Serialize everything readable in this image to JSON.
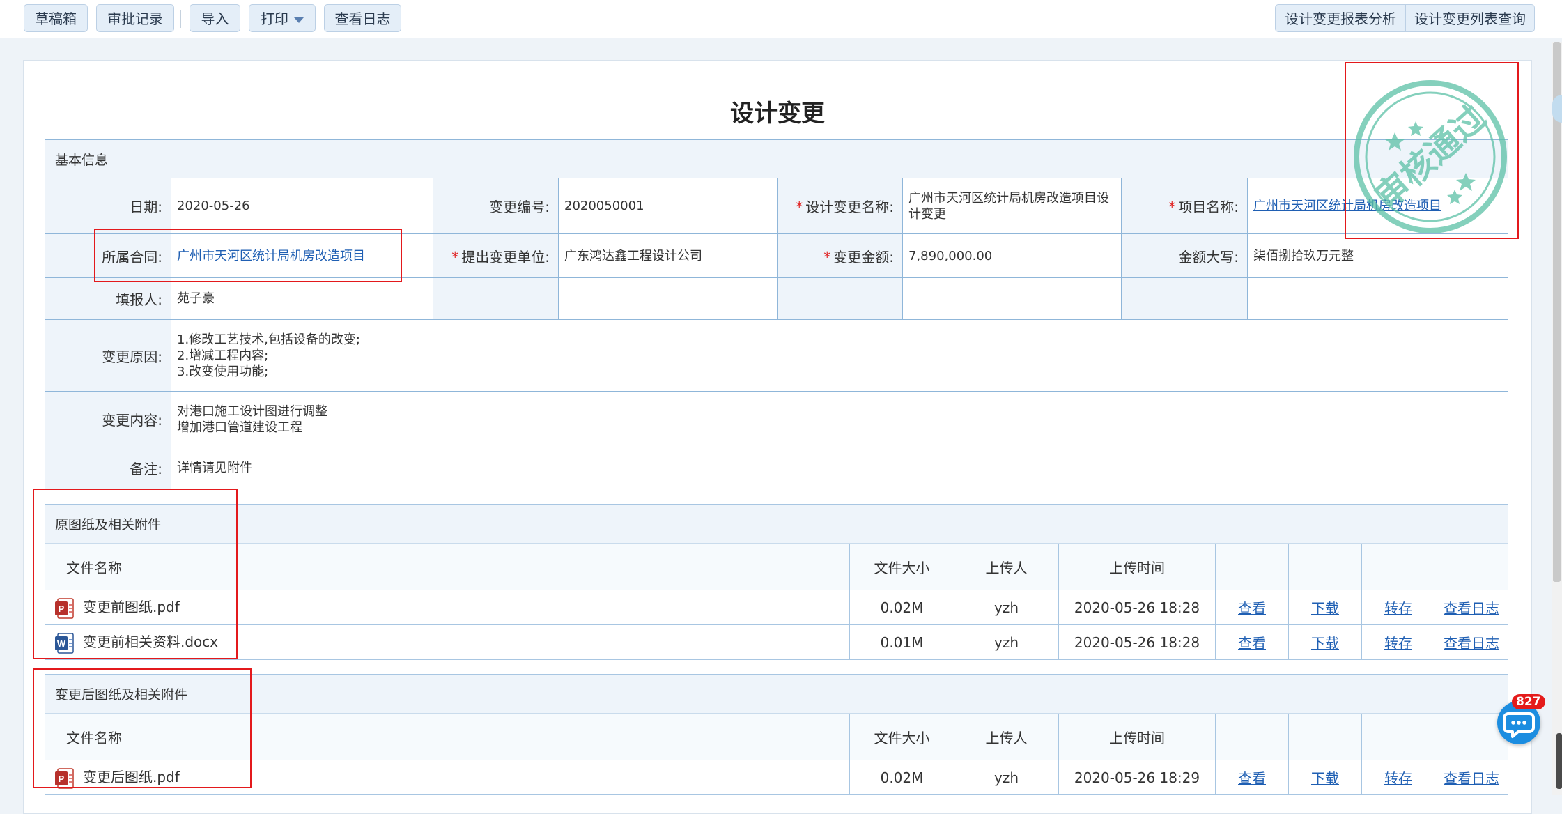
{
  "toolbar": {
    "drafts": "草稿箱",
    "approval_records": "审批记录",
    "import": "导入",
    "print": "打印",
    "view_log": "查看日志",
    "report_analysis": "设计变更报表分析",
    "list_query": "设计变更列表查询"
  },
  "document": {
    "title": "设计变更"
  },
  "basic_info": {
    "section_title": "基本信息",
    "date_label": "日期:",
    "date": "2020-05-26",
    "change_no_label": "变更编号:",
    "change_no": "2020050001",
    "change_name_label": "设计变更名称:",
    "change_name": "广州市天河区统计局机房改造项目设计变更",
    "project_label": "项目名称:",
    "project": "广州市天河区统计局机房改造项目",
    "contract_label": "所属合同:",
    "contract": "广州市天河区统计局机房改造项目",
    "unit_label": "提出变更单位:",
    "unit": "广东鸿达鑫工程设计公司",
    "amount_label": "变更金额:",
    "amount": "7,890,000.00",
    "amount_words_label": "金额大写:",
    "amount_words": "柒佰捌拾玖万元整",
    "filler_label": "填报人:",
    "filler": "苑子豪",
    "reason_label": "变更原因:",
    "reason": "1.修改工艺技术,包括设备的改变;\n2.增减工程内容;\n3.改变使用功能;",
    "content_label": "变更内容:",
    "content": "对港口施工设计图进行调整\n增加港口管道建设工程",
    "remark_label": "备注:",
    "remark": "详情请见附件"
  },
  "attachments_before": {
    "section_title": "原图纸及相关附件",
    "headers": {
      "name": "文件名称",
      "size": "文件大小",
      "uploader": "上传人",
      "time": "上传时间"
    },
    "files": [
      {
        "name": "变更前图纸.pdf",
        "type": "pdf",
        "size": "0.02M",
        "uploader": "yzh",
        "time": "2020-05-26 18:28"
      },
      {
        "name": "变更前相关资料.docx",
        "type": "word",
        "size": "0.01M",
        "uploader": "yzh",
        "time": "2020-05-26 18:28"
      }
    ]
  },
  "attachments_after": {
    "section_title": "变更后图纸及相关附件",
    "headers": {
      "name": "文件名称",
      "size": "文件大小",
      "uploader": "上传人",
      "time": "上传时间"
    },
    "files": [
      {
        "name": "变更后图纸.pdf",
        "type": "pdf",
        "size": "0.02M",
        "uploader": "yzh",
        "time": "2020-05-26 18:29"
      }
    ]
  },
  "actions": {
    "view": "查看",
    "download": "下载",
    "save": "转存",
    "log": "查看日志"
  },
  "stamp": {
    "text": "审核通过",
    "color": "#5cc1a6"
  },
  "chat": {
    "badge": "827",
    "icon": "chat-bubble-icon"
  },
  "colors": {
    "accent": "#1f5fb3",
    "required": "#e02020",
    "annotation": "#e3191c"
  }
}
